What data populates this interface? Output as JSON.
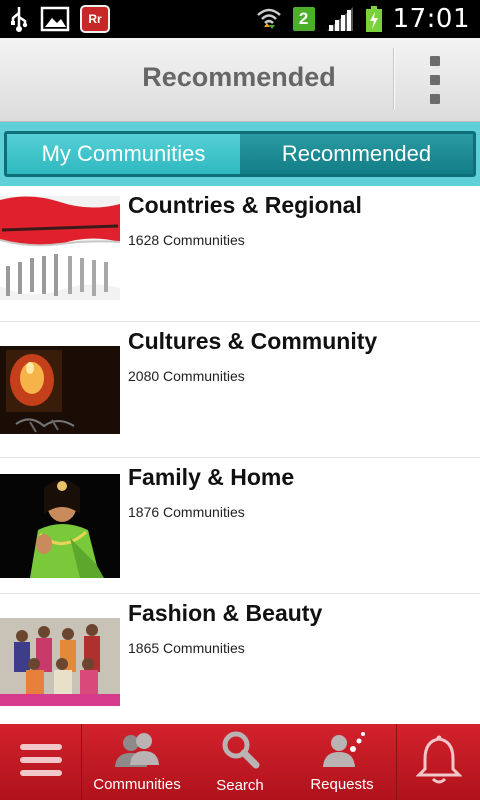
{
  "status_bar": {
    "icons": [
      "usb-icon",
      "image-icon",
      "app-notification-icon"
    ],
    "app_badge_text": "Rr",
    "network_badge": "2",
    "time": "17:01"
  },
  "action_bar": {
    "title": "Recommended",
    "overflow_menu_icon": "overflow-menu-icon"
  },
  "tabs": [
    {
      "label": "My Communities",
      "active": true
    },
    {
      "label": "Recommended",
      "active": false
    }
  ],
  "categories": [
    {
      "title": "Countries & Regional",
      "count": "1628 Communities"
    },
    {
      "title": "Cultures & Community",
      "count": "2080 Communities"
    },
    {
      "title": "Family & Home",
      "count": "1876 Communities"
    },
    {
      "title": "Fashion & Beauty",
      "count": "1865 Communities"
    }
  ],
  "bottom_nav": {
    "menu_icon": "hamburger-menu-icon",
    "communities_label": "Communities",
    "search_label": "Search",
    "requests_label": "Requests",
    "notifications_icon": "bell-icon"
  },
  "colors": {
    "accent_teal": "#5fd0d8",
    "brand_red": "#c41a24",
    "tab_active": "#3fc2ca",
    "tab_inactive": "#1d8a93"
  }
}
